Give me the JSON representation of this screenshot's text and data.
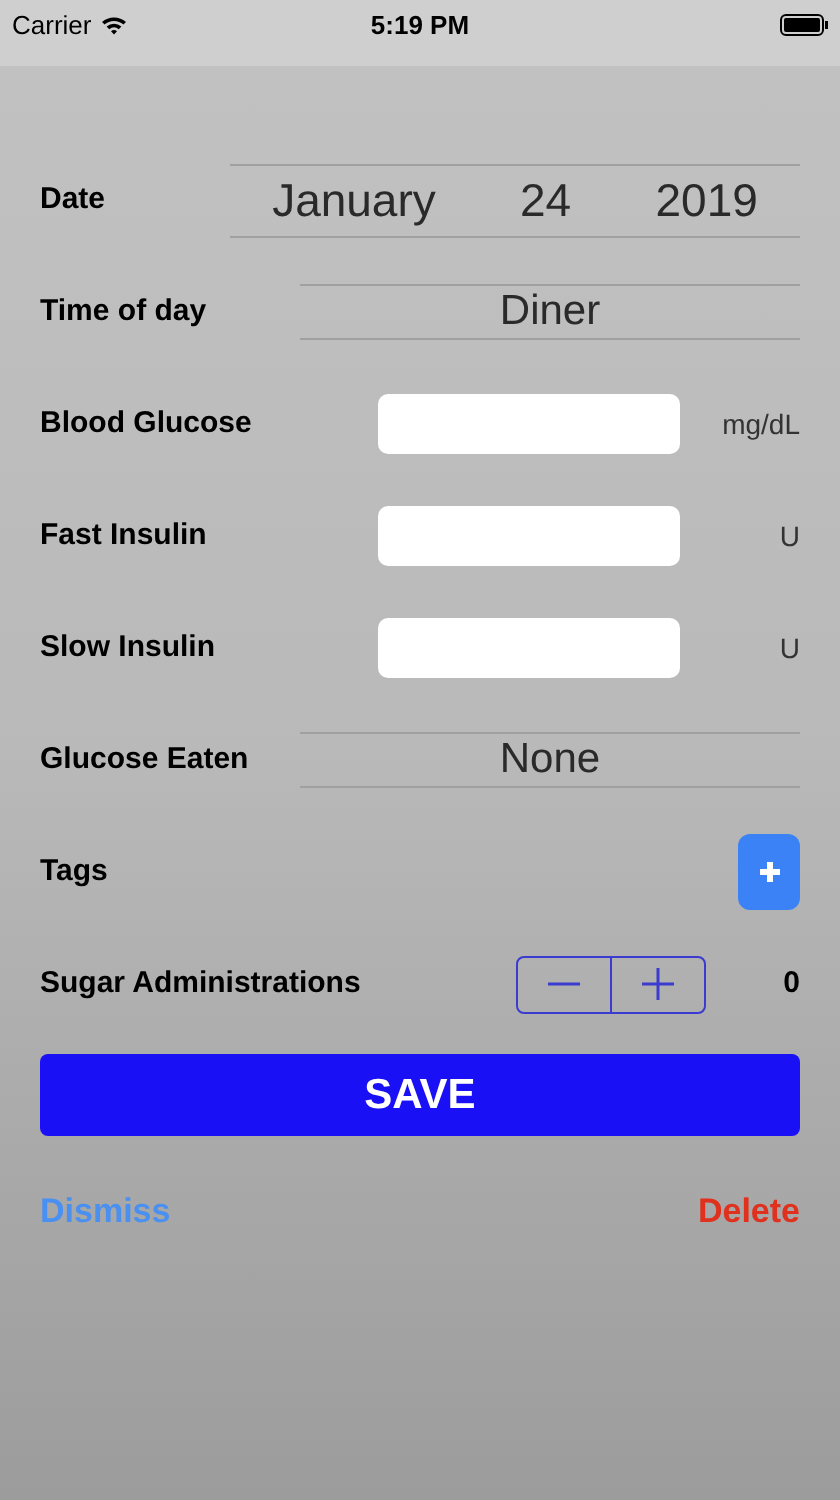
{
  "status_bar": {
    "carrier": "Carrier",
    "time": "5:19 PM"
  },
  "rows": [
    {
      "kind": "date",
      "label": "Date",
      "parts": [
        "January",
        "24",
        "2019"
      ]
    },
    {
      "kind": "picker",
      "label": "Time of day",
      "value": "Diner"
    },
    {
      "kind": "field",
      "label": "Blood Glucose",
      "unit": "mg/dL"
    },
    {
      "kind": "field",
      "label": "Fast Insulin",
      "unit": "U"
    },
    {
      "kind": "field",
      "label": "Slow Insulin",
      "unit": "U"
    },
    {
      "kind": "picker",
      "label": "Glucose Eaten",
      "value": "None"
    },
    {
      "kind": "tags",
      "label": "Tags"
    },
    {
      "kind": "stepper",
      "label": "Sugar Administrations",
      "value": "0"
    }
  ],
  "save_button": "SAVE",
  "dismiss_link": "Dismiss",
  "delete_link": "Delete"
}
